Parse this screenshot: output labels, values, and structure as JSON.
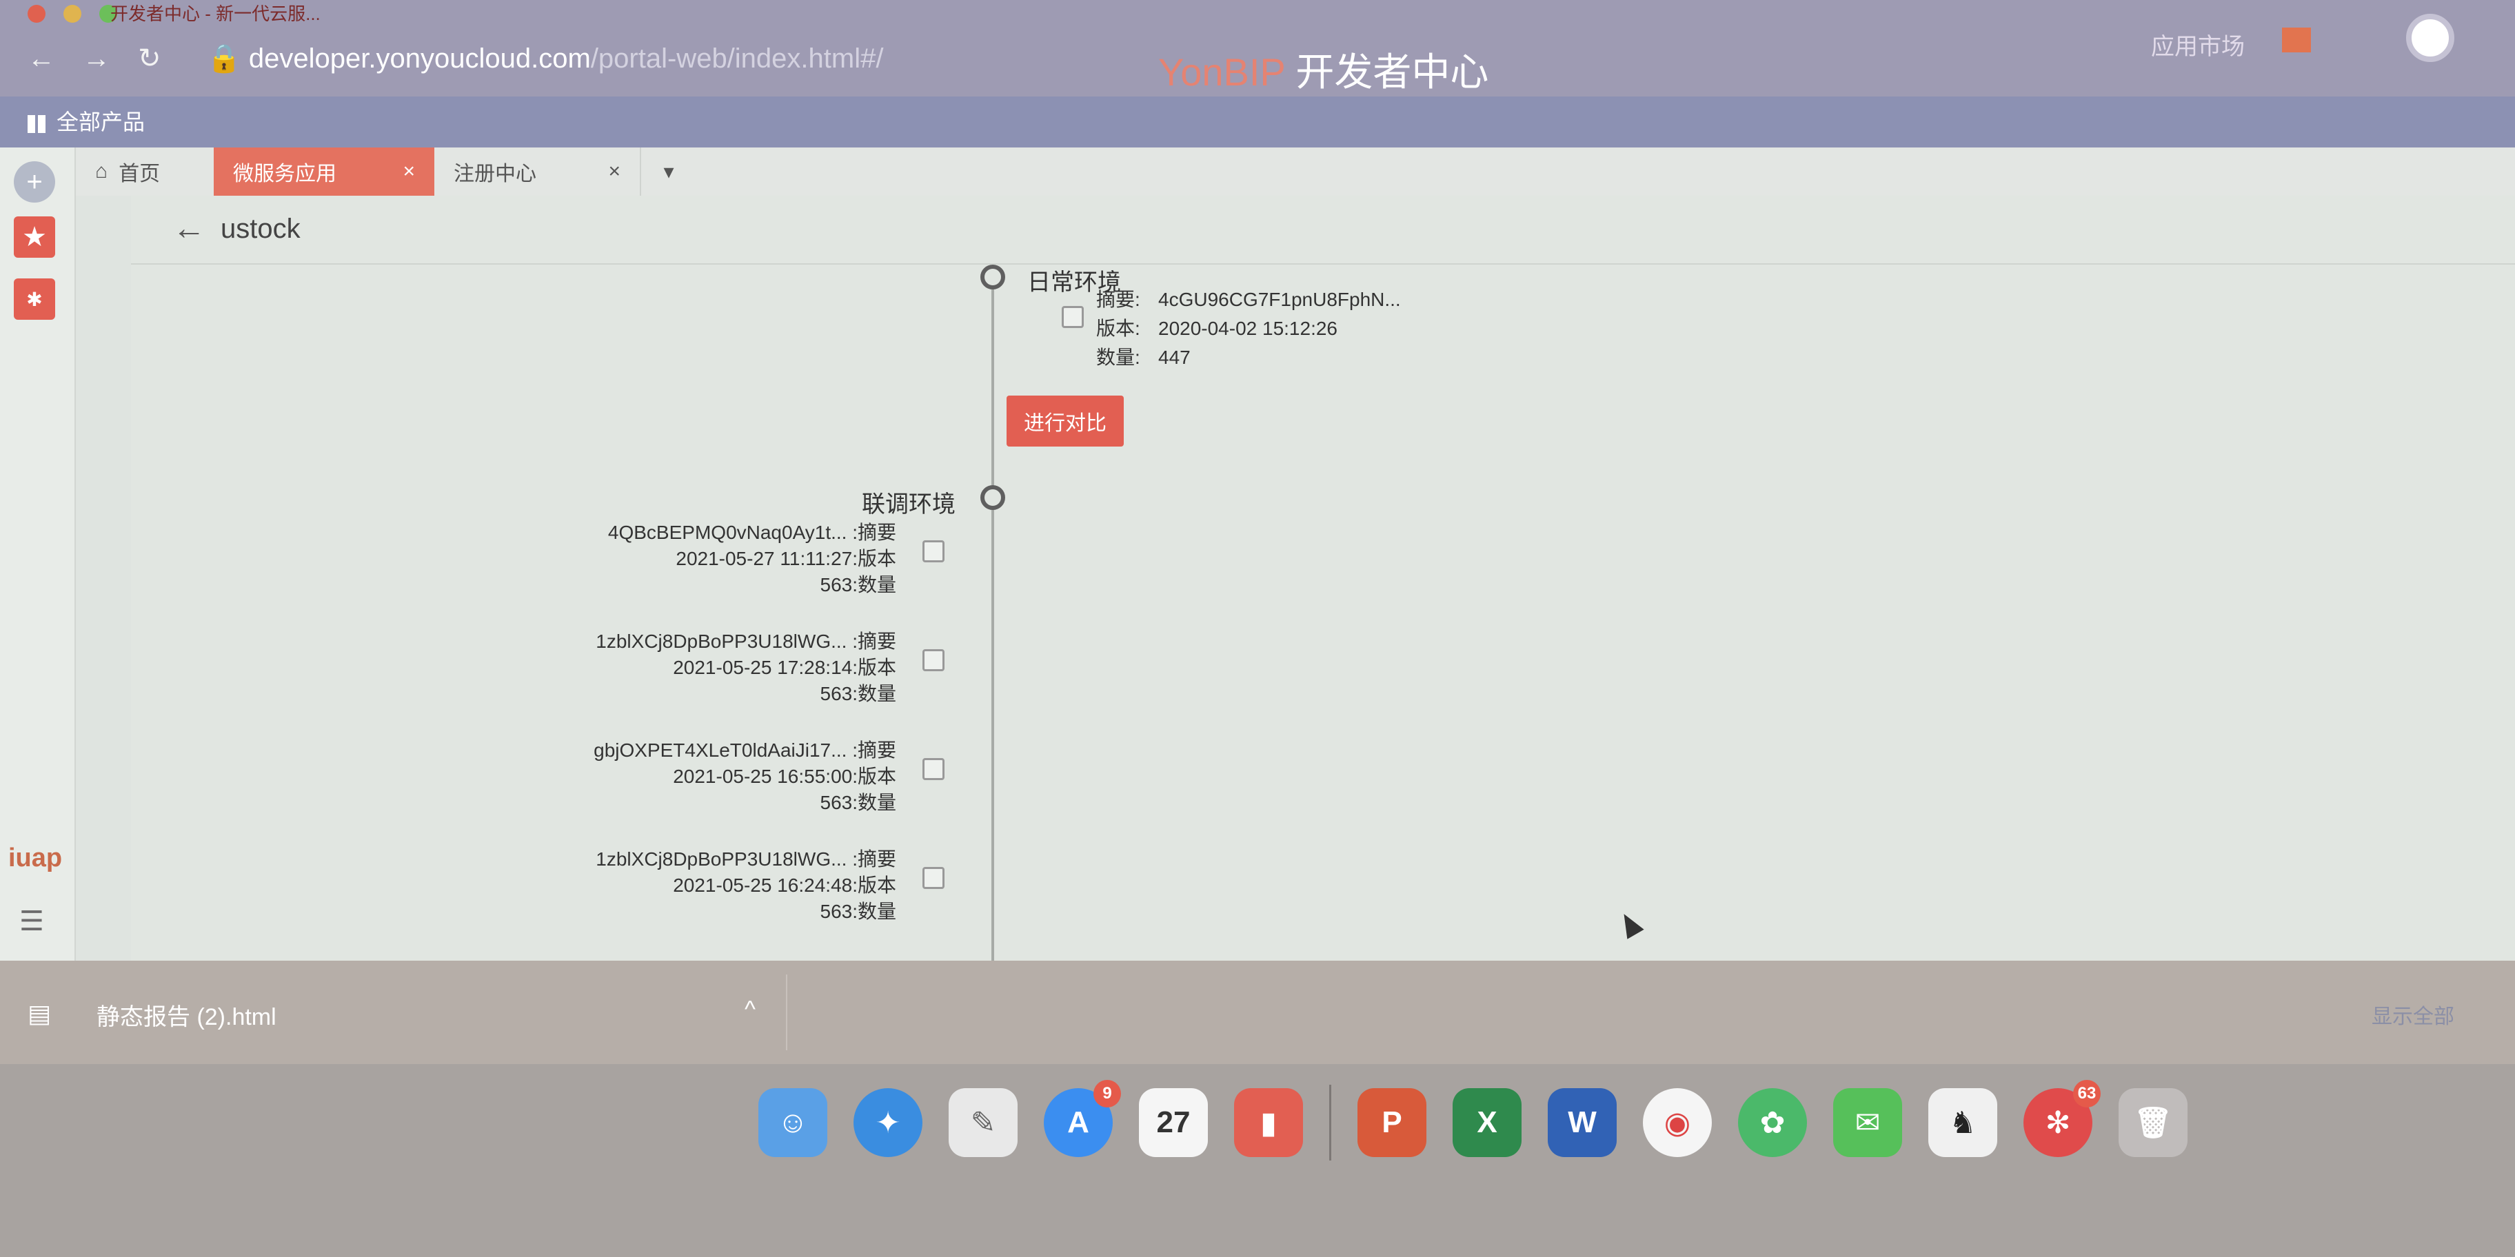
{
  "browser": {
    "tab_title": "开发者中心 - 新一代云服...",
    "url_host": "developer.yonyoucloud.com",
    "url_path": "/portal-web/index.html#/"
  },
  "header": {
    "brand_yon": "YonBIP",
    "brand_rest": "开发者中心",
    "market": "应用市场"
  },
  "products_bar": {
    "label": "全部产品"
  },
  "tabs": [
    {
      "label": "首页"
    },
    {
      "label": "微服务应用",
      "close": "×"
    },
    {
      "label": "注册中心",
      "close": "×"
    }
  ],
  "page": {
    "title": "ustock"
  },
  "daily": {
    "label": "日常环境",
    "summary_key": "摘要:",
    "summary": "4cGU96CG7F1pnU8FphN...",
    "version_key": "版本:",
    "version": "2020-04-02 15:12:26",
    "count_key": "数量:",
    "count": "447"
  },
  "compare_button": "进行对比",
  "joint": {
    "label": "联调环境",
    "items": [
      {
        "summary": "4QBcBEPMQ0vNaq0Ay1t... :摘要",
        "version": "2021-05-27 11:11:27:版本",
        "count": "563:数量"
      },
      {
        "summary": "1zblXCj8DpBoPP3U18lWG... :摘要",
        "version": "2021-05-25 17:28:14:版本",
        "count": "563:数量"
      },
      {
        "summary": "gbjOXPET4XLeT0ldAaiJi17... :摘要",
        "version": "2021-05-25 16:55:00:版本",
        "count": "563:数量"
      },
      {
        "summary": "1zblXCj8DpBoPP3U18lWG... :摘要",
        "version": "2021-05-25 16:24:48:版本",
        "count": "563:数量"
      }
    ]
  },
  "sidebar": {
    "logo": "iuap"
  },
  "download": {
    "filename": "静态报告 (2).html",
    "show_all": "显示全部"
  },
  "dock": {
    "calendar_day": "27",
    "appstore_badge": "9",
    "app_badge": "63"
  },
  "colors": {
    "accent": "#e25f52",
    "chrome": "#9e9bb3"
  }
}
